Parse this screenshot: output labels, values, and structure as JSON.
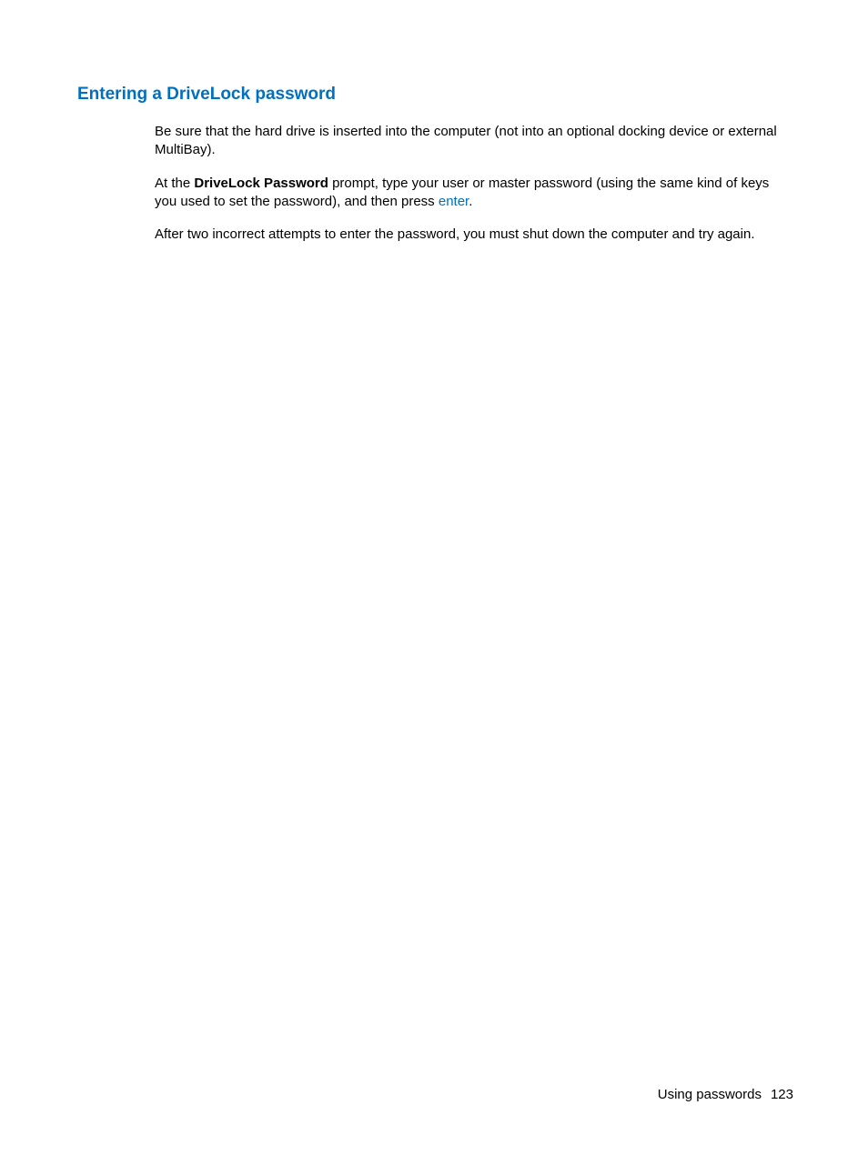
{
  "heading": "Entering a DriveLock password",
  "paragraphs": {
    "p1": "Be sure that the hard drive is inserted into the computer (not into an optional docking device or external MultiBay).",
    "p2_part1": "At the ",
    "p2_bold": "DriveLock Password",
    "p2_part2": " prompt, type your user or master password (using the same kind of keys you used to set the password), and then press ",
    "p2_key": "enter",
    "p2_part3": ".",
    "p3": "After two incorrect attempts to enter the password, you must shut down the computer and try again."
  },
  "footer": {
    "section": "Using passwords",
    "page_number": "123"
  }
}
